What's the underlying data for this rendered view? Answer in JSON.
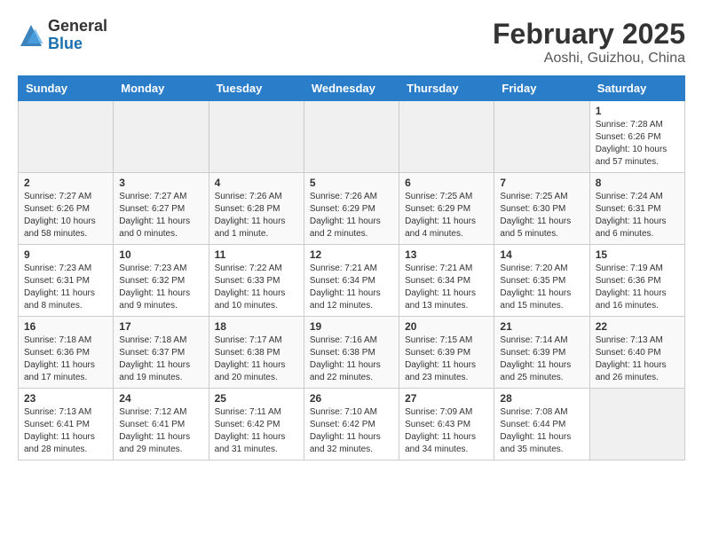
{
  "header": {
    "logo_general": "General",
    "logo_blue": "Blue",
    "title": "February 2025",
    "subtitle": "Aoshi, Guizhou, China"
  },
  "weekdays": [
    "Sunday",
    "Monday",
    "Tuesday",
    "Wednesday",
    "Thursday",
    "Friday",
    "Saturday"
  ],
  "rows": [
    [
      {
        "day": "",
        "info": ""
      },
      {
        "day": "",
        "info": ""
      },
      {
        "day": "",
        "info": ""
      },
      {
        "day": "",
        "info": ""
      },
      {
        "day": "",
        "info": ""
      },
      {
        "day": "",
        "info": ""
      },
      {
        "day": "1",
        "info": "Sunrise: 7:28 AM\nSunset: 6:26 PM\nDaylight: 10 hours and 57 minutes."
      }
    ],
    [
      {
        "day": "2",
        "info": "Sunrise: 7:27 AM\nSunset: 6:26 PM\nDaylight: 10 hours and 58 minutes."
      },
      {
        "day": "3",
        "info": "Sunrise: 7:27 AM\nSunset: 6:27 PM\nDaylight: 11 hours and 0 minutes."
      },
      {
        "day": "4",
        "info": "Sunrise: 7:26 AM\nSunset: 6:28 PM\nDaylight: 11 hours and 1 minute."
      },
      {
        "day": "5",
        "info": "Sunrise: 7:26 AM\nSunset: 6:29 PM\nDaylight: 11 hours and 2 minutes."
      },
      {
        "day": "6",
        "info": "Sunrise: 7:25 AM\nSunset: 6:29 PM\nDaylight: 11 hours and 4 minutes."
      },
      {
        "day": "7",
        "info": "Sunrise: 7:25 AM\nSunset: 6:30 PM\nDaylight: 11 hours and 5 minutes."
      },
      {
        "day": "8",
        "info": "Sunrise: 7:24 AM\nSunset: 6:31 PM\nDaylight: 11 hours and 6 minutes."
      }
    ],
    [
      {
        "day": "9",
        "info": "Sunrise: 7:23 AM\nSunset: 6:31 PM\nDaylight: 11 hours and 8 minutes."
      },
      {
        "day": "10",
        "info": "Sunrise: 7:23 AM\nSunset: 6:32 PM\nDaylight: 11 hours and 9 minutes."
      },
      {
        "day": "11",
        "info": "Sunrise: 7:22 AM\nSunset: 6:33 PM\nDaylight: 11 hours and 10 minutes."
      },
      {
        "day": "12",
        "info": "Sunrise: 7:21 AM\nSunset: 6:34 PM\nDaylight: 11 hours and 12 minutes."
      },
      {
        "day": "13",
        "info": "Sunrise: 7:21 AM\nSunset: 6:34 PM\nDaylight: 11 hours and 13 minutes."
      },
      {
        "day": "14",
        "info": "Sunrise: 7:20 AM\nSunset: 6:35 PM\nDaylight: 11 hours and 15 minutes."
      },
      {
        "day": "15",
        "info": "Sunrise: 7:19 AM\nSunset: 6:36 PM\nDaylight: 11 hours and 16 minutes."
      }
    ],
    [
      {
        "day": "16",
        "info": "Sunrise: 7:18 AM\nSunset: 6:36 PM\nDaylight: 11 hours and 17 minutes."
      },
      {
        "day": "17",
        "info": "Sunrise: 7:18 AM\nSunset: 6:37 PM\nDaylight: 11 hours and 19 minutes."
      },
      {
        "day": "18",
        "info": "Sunrise: 7:17 AM\nSunset: 6:38 PM\nDaylight: 11 hours and 20 minutes."
      },
      {
        "day": "19",
        "info": "Sunrise: 7:16 AM\nSunset: 6:38 PM\nDaylight: 11 hours and 22 minutes."
      },
      {
        "day": "20",
        "info": "Sunrise: 7:15 AM\nSunset: 6:39 PM\nDaylight: 11 hours and 23 minutes."
      },
      {
        "day": "21",
        "info": "Sunrise: 7:14 AM\nSunset: 6:39 PM\nDaylight: 11 hours and 25 minutes."
      },
      {
        "day": "22",
        "info": "Sunrise: 7:13 AM\nSunset: 6:40 PM\nDaylight: 11 hours and 26 minutes."
      }
    ],
    [
      {
        "day": "23",
        "info": "Sunrise: 7:13 AM\nSunset: 6:41 PM\nDaylight: 11 hours and 28 minutes."
      },
      {
        "day": "24",
        "info": "Sunrise: 7:12 AM\nSunset: 6:41 PM\nDaylight: 11 hours and 29 minutes."
      },
      {
        "day": "25",
        "info": "Sunrise: 7:11 AM\nSunset: 6:42 PM\nDaylight: 11 hours and 31 minutes."
      },
      {
        "day": "26",
        "info": "Sunrise: 7:10 AM\nSunset: 6:42 PM\nDaylight: 11 hours and 32 minutes."
      },
      {
        "day": "27",
        "info": "Sunrise: 7:09 AM\nSunset: 6:43 PM\nDaylight: 11 hours and 34 minutes."
      },
      {
        "day": "28",
        "info": "Sunrise: 7:08 AM\nSunset: 6:44 PM\nDaylight: 11 hours and 35 minutes."
      },
      {
        "day": "",
        "info": ""
      }
    ]
  ]
}
